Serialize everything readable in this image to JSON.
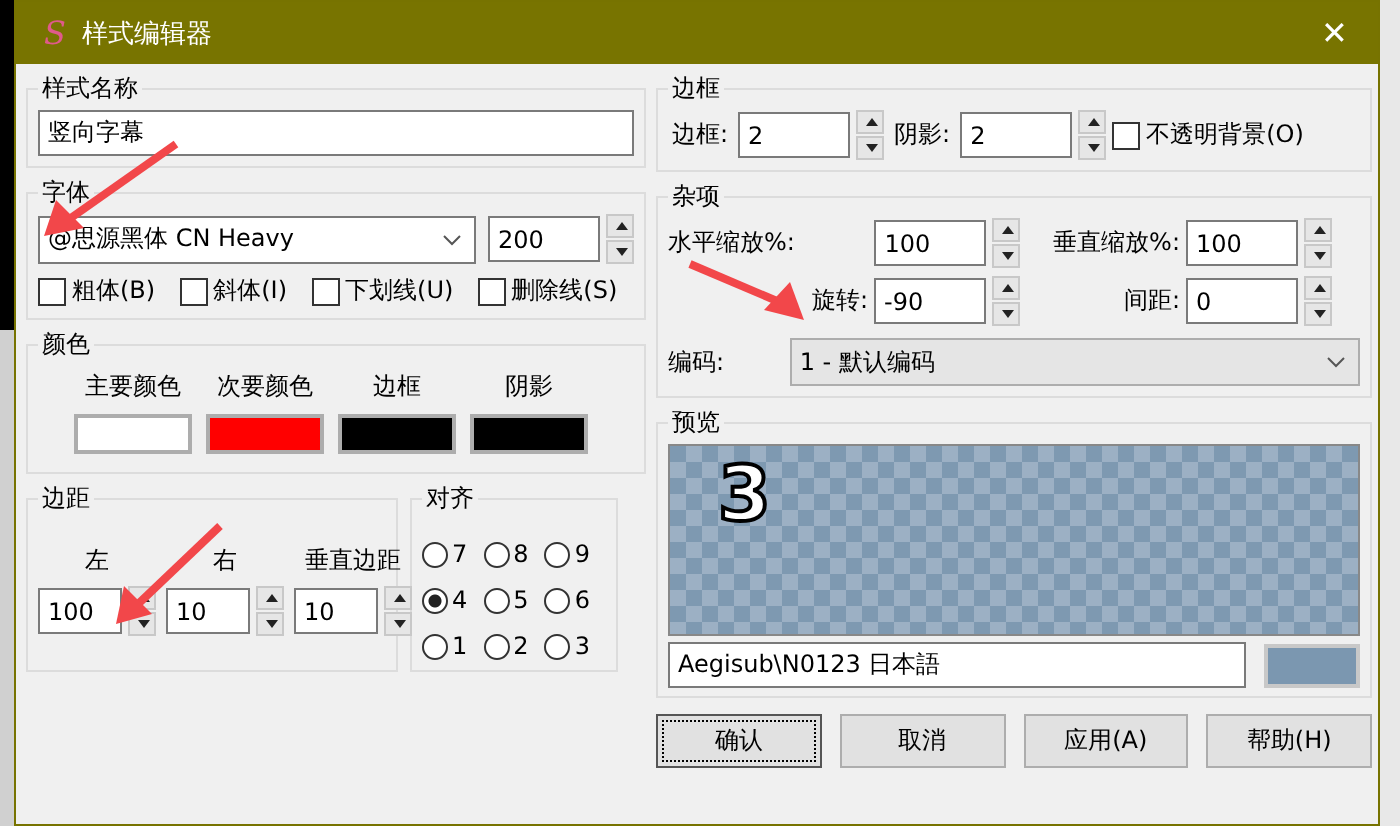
{
  "window": {
    "app_icon": "S",
    "title": "样式编辑器",
    "close": "✕"
  },
  "style_name": {
    "label": "样式名称",
    "value": "竖向字幕"
  },
  "font": {
    "label": "字体",
    "name": "@思源黑体 CN Heavy",
    "size": "200",
    "options": [
      {
        "label": "粗体(B)",
        "checked": false
      },
      {
        "label": "斜体(I)",
        "checked": false
      },
      {
        "label": "下划线(U)",
        "checked": false
      },
      {
        "label": "删除线(S)",
        "checked": false
      }
    ]
  },
  "colors": {
    "label": "颜色",
    "items": [
      {
        "label": "主要颜色",
        "color": "#ffffff"
      },
      {
        "label": "次要颜色",
        "color": "#ff0000"
      },
      {
        "label": "边框",
        "color": "#000000"
      },
      {
        "label": "阴影",
        "color": "#000000"
      }
    ]
  },
  "margins": {
    "label": "边距",
    "fields": [
      {
        "label": "左",
        "value": "100"
      },
      {
        "label": "右",
        "value": "10"
      },
      {
        "label": "垂直边距",
        "value": "10"
      }
    ]
  },
  "alignment": {
    "label": "对齐",
    "options": [
      {
        "label": "7",
        "selected": false
      },
      {
        "label": "8",
        "selected": false
      },
      {
        "label": "9",
        "selected": false
      },
      {
        "label": "4",
        "selected": true
      },
      {
        "label": "5",
        "selected": false
      },
      {
        "label": "6",
        "selected": false
      },
      {
        "label": "1",
        "selected": false
      },
      {
        "label": "2",
        "selected": false
      },
      {
        "label": "3",
        "selected": false
      }
    ]
  },
  "border": {
    "label": "边框",
    "outline_label": "边框:",
    "outline": "2",
    "shadow_label": "阴影:",
    "shadow": "2",
    "opaque_box": {
      "label": "不透明背景(O)",
      "checked": false
    }
  },
  "misc": {
    "label": "杂项",
    "fields": [
      {
        "label": "水平缩放%:",
        "value": "100"
      },
      {
        "label": "垂直缩放%:",
        "value": "100"
      },
      {
        "label": "旋转:",
        "value": "-90"
      },
      {
        "label": "间距:",
        "value": "0"
      }
    ],
    "encoding_label": "编码:",
    "encoding": "1 - 默认编码"
  },
  "preview": {
    "label": "预览",
    "rendered_text": "3",
    "sample": "Aegisub\\N0123 日本語"
  },
  "buttons": [
    {
      "label": "确认",
      "default": true
    },
    {
      "label": "取消",
      "default": false
    },
    {
      "label": "应用(A)",
      "default": false
    },
    {
      "label": "帮助(H)",
      "default": false
    }
  ]
}
